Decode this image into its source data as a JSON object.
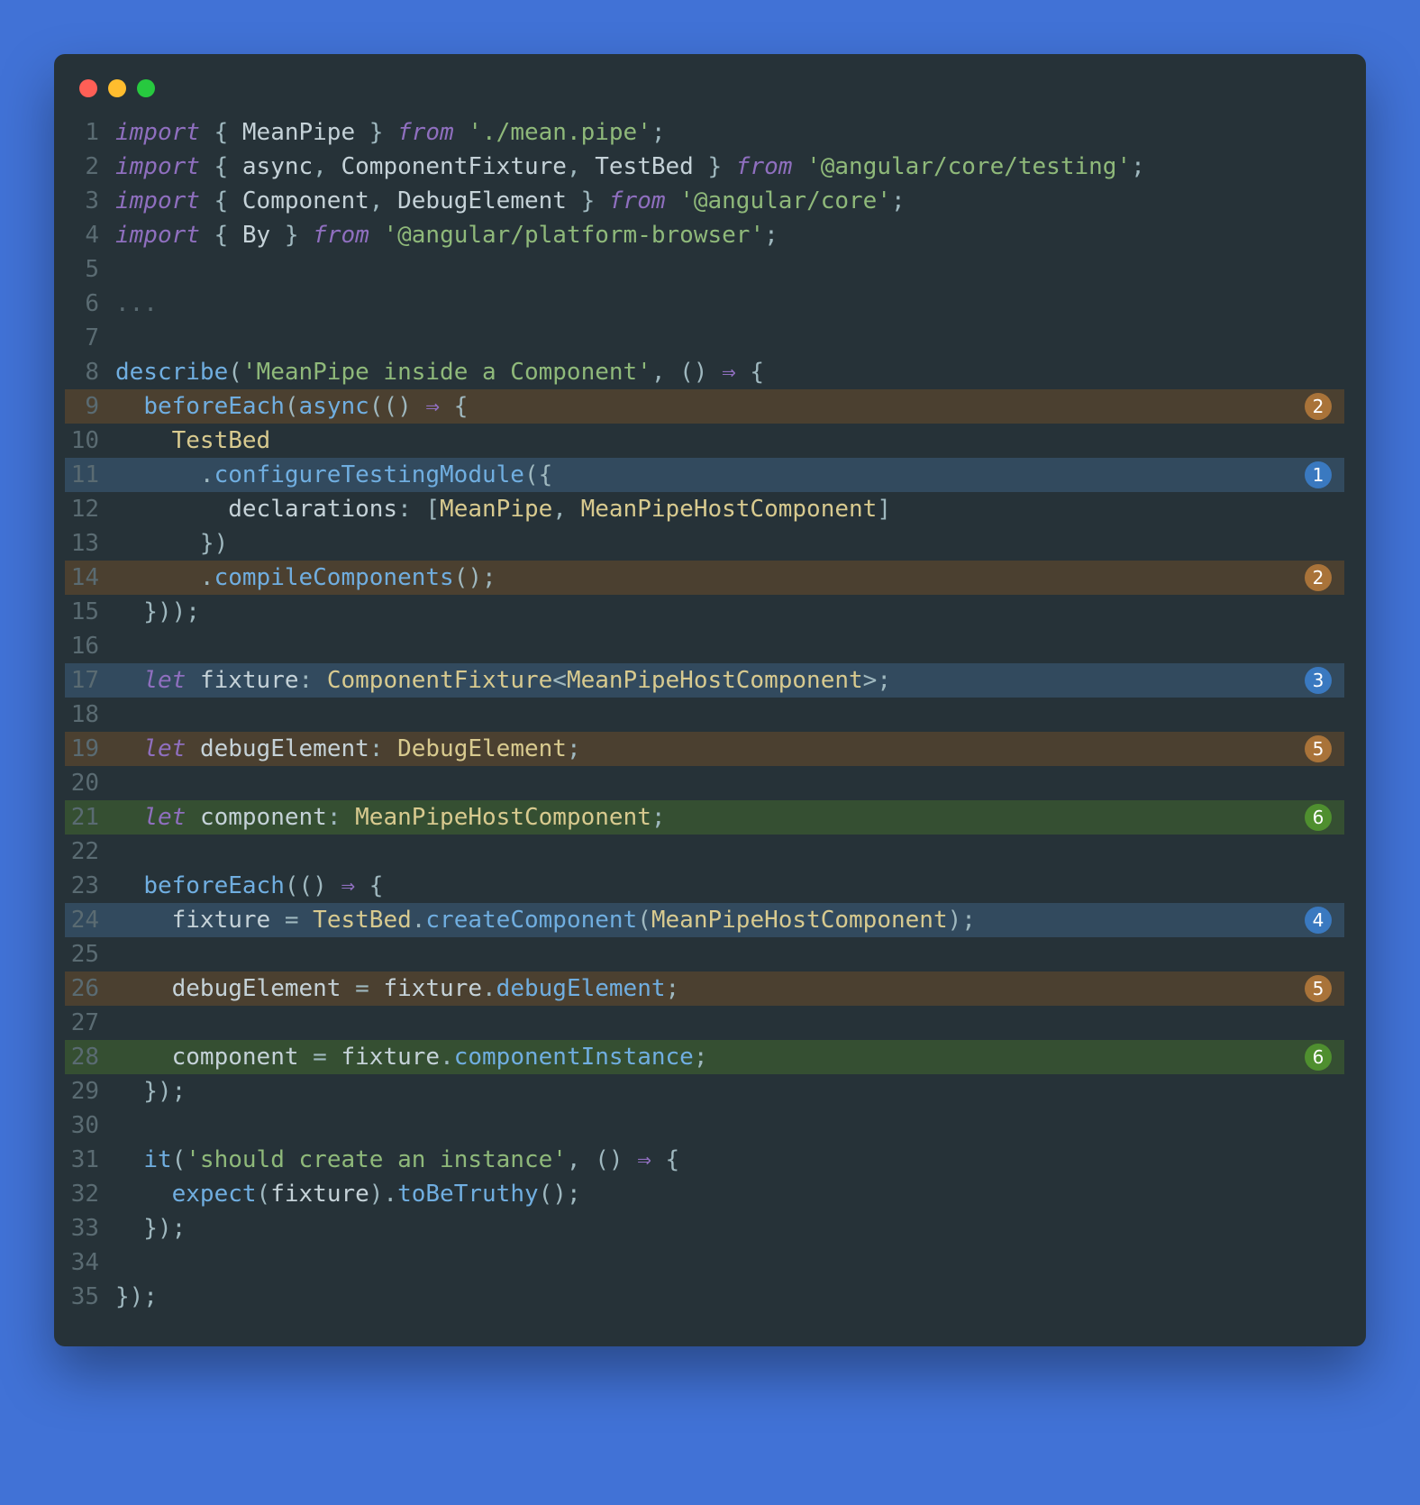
{
  "lines": [
    {
      "num": 1,
      "hl": "",
      "badge": null,
      "tokens": [
        [
          "kw",
          "import"
        ],
        [
          "pn",
          " { "
        ],
        [
          "vr",
          "MeanPipe"
        ],
        [
          "pn",
          " } "
        ],
        [
          "kw",
          "from"
        ],
        [
          "pn",
          " "
        ],
        [
          "str",
          "'./mean.pipe'"
        ],
        [
          "pn",
          ";"
        ]
      ]
    },
    {
      "num": 2,
      "hl": "",
      "badge": null,
      "tokens": [
        [
          "kw",
          "import"
        ],
        [
          "pn",
          " { "
        ],
        [
          "vr",
          "async"
        ],
        [
          "pn",
          ", "
        ],
        [
          "vr",
          "ComponentFixture"
        ],
        [
          "pn",
          ", "
        ],
        [
          "vr",
          "TestBed"
        ],
        [
          "pn",
          " } "
        ],
        [
          "kw",
          "from"
        ],
        [
          "pn",
          " "
        ],
        [
          "str",
          "'@angular/core/testing'"
        ],
        [
          "pn",
          ";"
        ]
      ]
    },
    {
      "num": 3,
      "hl": "",
      "badge": null,
      "tokens": [
        [
          "kw",
          "import"
        ],
        [
          "pn",
          " { "
        ],
        [
          "vr",
          "Component"
        ],
        [
          "pn",
          ", "
        ],
        [
          "vr",
          "DebugElement"
        ],
        [
          "pn",
          " } "
        ],
        [
          "kw",
          "from"
        ],
        [
          "pn",
          " "
        ],
        [
          "str",
          "'@angular/core'"
        ],
        [
          "pn",
          ";"
        ]
      ]
    },
    {
      "num": 4,
      "hl": "",
      "badge": null,
      "tokens": [
        [
          "kw",
          "import"
        ],
        [
          "pn",
          " { "
        ],
        [
          "vr",
          "By"
        ],
        [
          "pn",
          " } "
        ],
        [
          "kw",
          "from"
        ],
        [
          "pn",
          " "
        ],
        [
          "str",
          "'@angular/platform-browser'"
        ],
        [
          "pn",
          ";"
        ]
      ]
    },
    {
      "num": 5,
      "hl": "",
      "badge": null,
      "tokens": []
    },
    {
      "num": 6,
      "hl": "",
      "badge": null,
      "tokens": [
        [
          "dim",
          "..."
        ]
      ]
    },
    {
      "num": 7,
      "hl": "",
      "badge": null,
      "tokens": []
    },
    {
      "num": 8,
      "hl": "",
      "badge": null,
      "tokens": [
        [
          "fn",
          "describe"
        ],
        [
          "pn",
          "("
        ],
        [
          "str",
          "'MeanPipe inside a Component'"
        ],
        [
          "pn",
          ", () "
        ],
        [
          "kw",
          "⇒"
        ],
        [
          "pn",
          " {"
        ]
      ]
    },
    {
      "num": 9,
      "hl": "hl-brown",
      "badge": {
        "n": "2",
        "color": "c-brown"
      },
      "tokens": [
        [
          "pn",
          "  "
        ],
        [
          "fn",
          "beforeEach"
        ],
        [
          "pn",
          "("
        ],
        [
          "fn",
          "async"
        ],
        [
          "pn",
          "(() "
        ],
        [
          "kw",
          "⇒"
        ],
        [
          "pn",
          " {"
        ]
      ]
    },
    {
      "num": 10,
      "hl": "",
      "badge": null,
      "tokens": [
        [
          "pn",
          "    "
        ],
        [
          "ty",
          "TestBed"
        ]
      ]
    },
    {
      "num": 11,
      "hl": "hl-blue",
      "badge": {
        "n": "1",
        "color": "c-blue"
      },
      "tokens": [
        [
          "pn",
          "      ."
        ],
        [
          "fn",
          "configureTestingModule"
        ],
        [
          "pn",
          "({"
        ]
      ]
    },
    {
      "num": 12,
      "hl": "",
      "badge": null,
      "tokens": [
        [
          "pn",
          "        "
        ],
        [
          "prop",
          "declarations"
        ],
        [
          "pn",
          ": ["
        ],
        [
          "ty",
          "MeanPipe"
        ],
        [
          "pn",
          ", "
        ],
        [
          "ty",
          "MeanPipeHostComponent"
        ],
        [
          "pn",
          "]"
        ]
      ]
    },
    {
      "num": 13,
      "hl": "",
      "badge": null,
      "tokens": [
        [
          "pn",
          "      })"
        ]
      ]
    },
    {
      "num": 14,
      "hl": "hl-brown",
      "badge": {
        "n": "2",
        "color": "c-brown"
      },
      "tokens": [
        [
          "pn",
          "      ."
        ],
        [
          "fn",
          "compileComponents"
        ],
        [
          "pn",
          "();"
        ]
      ]
    },
    {
      "num": 15,
      "hl": "",
      "badge": null,
      "tokens": [
        [
          "pn",
          "  }));"
        ]
      ]
    },
    {
      "num": 16,
      "hl": "",
      "badge": null,
      "tokens": []
    },
    {
      "num": 17,
      "hl": "hl-blue",
      "badge": {
        "n": "3",
        "color": "c-blue"
      },
      "tokens": [
        [
          "pn",
          "  "
        ],
        [
          "kw",
          "let"
        ],
        [
          "pn",
          " "
        ],
        [
          "vr",
          "fixture"
        ],
        [
          "pn",
          ": "
        ],
        [
          "ty",
          "ComponentFixture"
        ],
        [
          "pn",
          "<"
        ],
        [
          "ty",
          "MeanPipeHostComponent"
        ],
        [
          "pn",
          ">;"
        ]
      ]
    },
    {
      "num": 18,
      "hl": "",
      "badge": null,
      "tokens": []
    },
    {
      "num": 19,
      "hl": "hl-brown",
      "badge": {
        "n": "5",
        "color": "c-brown"
      },
      "tokens": [
        [
          "pn",
          "  "
        ],
        [
          "kw",
          "let"
        ],
        [
          "pn",
          " "
        ],
        [
          "vr",
          "debugElement"
        ],
        [
          "pn",
          ": "
        ],
        [
          "ty",
          "DebugElement"
        ],
        [
          "pn",
          ";"
        ]
      ]
    },
    {
      "num": 20,
      "hl": "",
      "badge": null,
      "tokens": []
    },
    {
      "num": 21,
      "hl": "hl-green",
      "badge": {
        "n": "6",
        "color": "c-green"
      },
      "tokens": [
        [
          "pn",
          "  "
        ],
        [
          "kw",
          "let"
        ],
        [
          "pn",
          " "
        ],
        [
          "vr",
          "component"
        ],
        [
          "pn",
          ": "
        ],
        [
          "ty",
          "MeanPipeHostComponent"
        ],
        [
          "pn",
          ";"
        ]
      ]
    },
    {
      "num": 22,
      "hl": "",
      "badge": null,
      "tokens": []
    },
    {
      "num": 23,
      "hl": "",
      "badge": null,
      "tokens": [
        [
          "pn",
          "  "
        ],
        [
          "fn",
          "beforeEach"
        ],
        [
          "pn",
          "(() "
        ],
        [
          "kw",
          "⇒"
        ],
        [
          "pn",
          " {"
        ]
      ]
    },
    {
      "num": 24,
      "hl": "hl-blue",
      "badge": {
        "n": "4",
        "color": "c-blue"
      },
      "tokens": [
        [
          "pn",
          "    "
        ],
        [
          "vr",
          "fixture"
        ],
        [
          "pn",
          " = "
        ],
        [
          "ty",
          "TestBed"
        ],
        [
          "pn",
          "."
        ],
        [
          "fn",
          "createComponent"
        ],
        [
          "pn",
          "("
        ],
        [
          "ty",
          "MeanPipeHostComponent"
        ],
        [
          "pn",
          ");"
        ]
      ]
    },
    {
      "num": 25,
      "hl": "",
      "badge": null,
      "tokens": []
    },
    {
      "num": 26,
      "hl": "hl-brown",
      "badge": {
        "n": "5",
        "color": "c-brown"
      },
      "tokens": [
        [
          "pn",
          "    "
        ],
        [
          "vr",
          "debugElement"
        ],
        [
          "pn",
          " = "
        ],
        [
          "vr",
          "fixture"
        ],
        [
          "pn",
          "."
        ],
        [
          "fn",
          "debugElement"
        ],
        [
          "pn",
          ";"
        ]
      ]
    },
    {
      "num": 27,
      "hl": "",
      "badge": null,
      "tokens": []
    },
    {
      "num": 28,
      "hl": "hl-green",
      "badge": {
        "n": "6",
        "color": "c-green"
      },
      "tokens": [
        [
          "pn",
          "    "
        ],
        [
          "vr",
          "component"
        ],
        [
          "pn",
          " = "
        ],
        [
          "vr",
          "fixture"
        ],
        [
          "pn",
          "."
        ],
        [
          "fn",
          "componentInstance"
        ],
        [
          "pn",
          ";"
        ]
      ]
    },
    {
      "num": 29,
      "hl": "",
      "badge": null,
      "tokens": [
        [
          "pn",
          "  });"
        ]
      ]
    },
    {
      "num": 30,
      "hl": "",
      "badge": null,
      "tokens": []
    },
    {
      "num": 31,
      "hl": "",
      "badge": null,
      "tokens": [
        [
          "pn",
          "  "
        ],
        [
          "fn",
          "it"
        ],
        [
          "pn",
          "("
        ],
        [
          "str",
          "'should create an instance'"
        ],
        [
          "pn",
          ", () "
        ],
        [
          "kw",
          "⇒"
        ],
        [
          "pn",
          " {"
        ]
      ]
    },
    {
      "num": 32,
      "hl": "",
      "badge": null,
      "tokens": [
        [
          "pn",
          "    "
        ],
        [
          "fn",
          "expect"
        ],
        [
          "pn",
          "("
        ],
        [
          "vr",
          "fixture"
        ],
        [
          "pn",
          ")."
        ],
        [
          "fn",
          "toBeTruthy"
        ],
        [
          "pn",
          "();"
        ]
      ]
    },
    {
      "num": 33,
      "hl": "",
      "badge": null,
      "tokens": [
        [
          "pn",
          "  });"
        ]
      ]
    },
    {
      "num": 34,
      "hl": "",
      "badge": null,
      "tokens": []
    },
    {
      "num": 35,
      "hl": "",
      "badge": null,
      "tokens": [
        [
          "pn",
          "});"
        ]
      ]
    }
  ]
}
